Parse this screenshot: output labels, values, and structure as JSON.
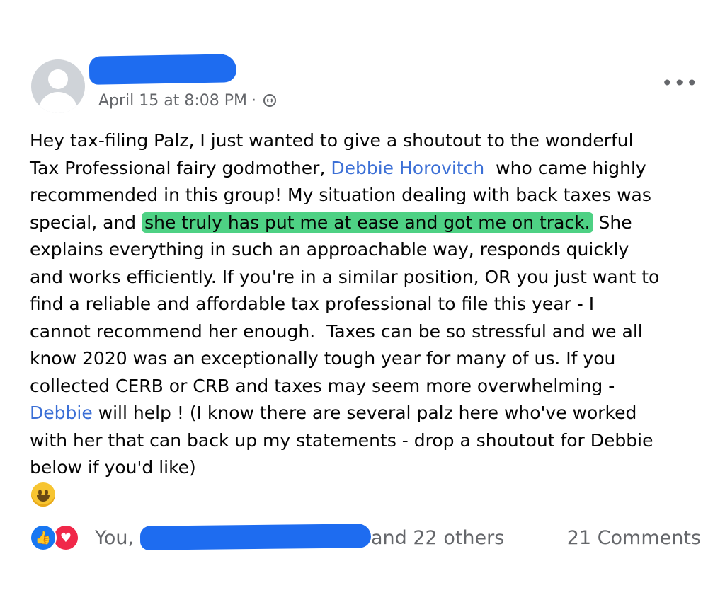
{
  "post": {
    "timestamp": "April 15 at 8:08 PM",
    "separator": "·",
    "privacy_icon": "globe-icon",
    "more_icon": "•••",
    "body": {
      "line1": "Hey tax-filing Palz, I just wanted to give a shoutout to the wonderful",
      "line2_a": "Tax Professional fairy godmother, ",
      "line2_mention": "Debbie Horovitch",
      "line2_b": "  who came highly",
      "line3": "recommended in this group! My situation dealing with back taxes was",
      "line4_a": "special, and ",
      "line4_highlight": "she truly has put me at ease and got me on track.",
      "line4_b": " She",
      "line5": "explains everything in such an approachable way, responds quickly",
      "line6": "and works efficiently. If you're in a similar position, OR you just want to",
      "line7": "find a reliable and affordable tax professional to file this year - I",
      "line8": "cannot recommend her enough.  Taxes can be so stressful and we all",
      "line9": "know 2020 was an exceptionally tough year for many of us. If you",
      "line10": "collected CERB or CRB and taxes may seem more overwhelming -",
      "line11_mention": "Debbie",
      "line11_b": " will help ! (I know there are several palz here who've worked",
      "line12": "with her that can back up my statements - drop a shoutout for Debbie",
      "line13": "below if you'd like)"
    },
    "emoji_icon": "grinning-face-icon",
    "reactions": {
      "like_icon": "👍",
      "love_icon": "♥",
      "lead": "You,",
      "tail": "and 22 others",
      "comments": "21 Comments"
    }
  },
  "colors": {
    "mention": "#3b6fd6",
    "highlight": "#4ed184",
    "redaction": "#1e6cf0",
    "secondary_text": "#65676b"
  }
}
